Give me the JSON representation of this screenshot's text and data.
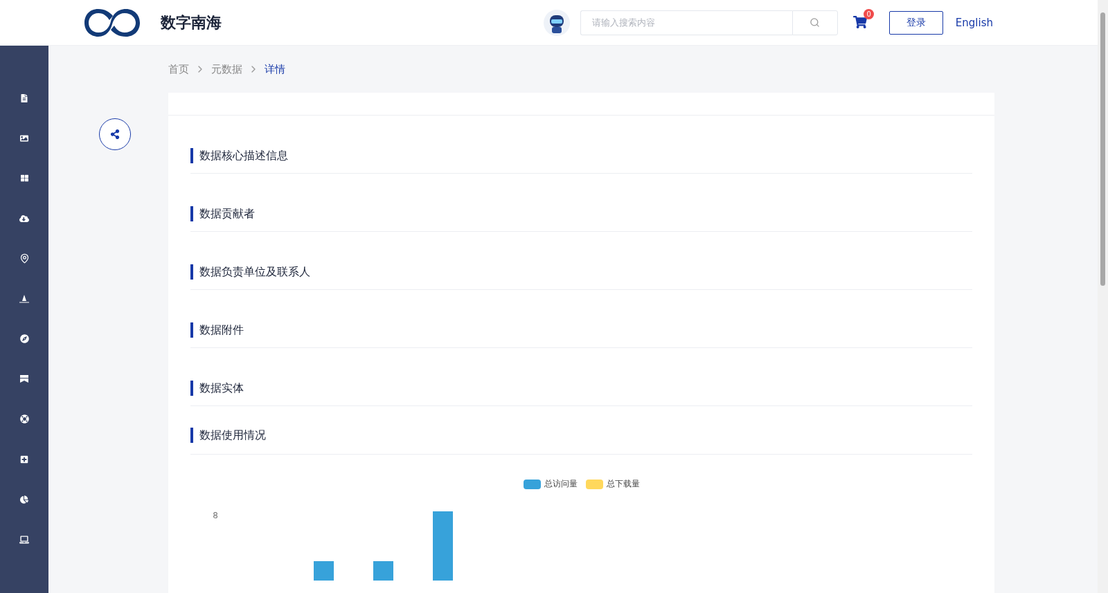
{
  "header": {
    "title": "数字南海",
    "search": {
      "placeholder": "请输入搜索内容"
    },
    "cart": {
      "badge": "0"
    },
    "login": "登录",
    "language": "English"
  },
  "sidebar": {
    "items": [
      {
        "kind": "document"
      },
      {
        "kind": "image"
      },
      {
        "kind": "grid"
      },
      {
        "kind": "cloud"
      },
      {
        "kind": "pin"
      },
      {
        "kind": "buoy"
      },
      {
        "kind": "compass"
      },
      {
        "kind": "banner"
      },
      {
        "kind": "ring"
      },
      {
        "kind": "plus"
      },
      {
        "kind": "pie"
      },
      {
        "kind": "laptop"
      }
    ]
  },
  "breadcrumb": [
    {
      "label": "首页",
      "selected": false
    },
    {
      "label": "元数据",
      "selected": false
    },
    {
      "label": "详情",
      "selected": true
    }
  ],
  "sections": [
    {
      "title": "数据核心描述信息"
    },
    {
      "title": "数据贡献者"
    },
    {
      "title": "数据负责单位及联系人"
    },
    {
      "title": "数据附件"
    },
    {
      "title": "数据实体"
    },
    {
      "title": "数据使用情况"
    }
  ],
  "chart": {
    "legend": [
      {
        "label": "总访问量",
        "color": "#37a2da"
      },
      {
        "label": "总下载量",
        "color": "#ffd85c"
      }
    ],
    "y_tick": "8"
  }
}
